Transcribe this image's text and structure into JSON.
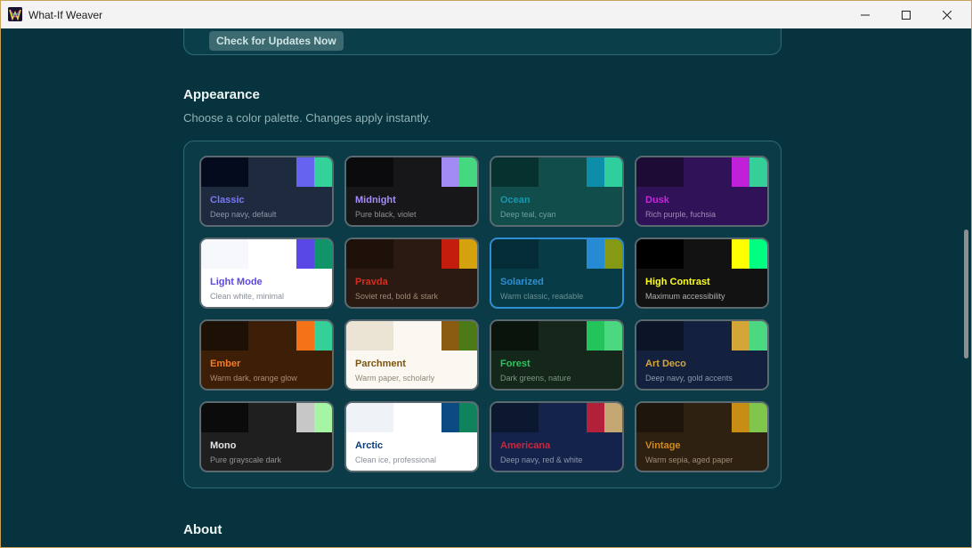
{
  "window": {
    "title": "What-If Weaver",
    "controls": {
      "minimize": "─",
      "maximize": "☐",
      "close": "✕"
    }
  },
  "updates": {
    "button_label": "Check for Updates Now"
  },
  "appearance": {
    "title": "Appearance",
    "subtitle": "Choose a color palette. Changes apply instantly.",
    "selected": "Solarized",
    "palettes": [
      {
        "name": "Classic",
        "desc": "Deep navy, default",
        "colors": [
          "#030b1c",
          "#1e2b3f",
          "#6563f0",
          "#35d19a"
        ],
        "bg": "#1e2b3f",
        "name_color": "#7b78f5",
        "desc_color": "#8b96a8"
      },
      {
        "name": "Midnight",
        "desc": "Pure black, violet",
        "colors": [
          "#0b0b0d",
          "#17171a",
          "#a28bf5",
          "#46d881"
        ],
        "bg": "#17171a",
        "name_color": "#a58df7",
        "desc_color": "#8f8f96"
      },
      {
        "name": "Ocean",
        "desc": "Deep teal, cyan",
        "colors": [
          "#06312e",
          "#114e4b",
          "#0d8ea8",
          "#2ecf9c"
        ],
        "bg": "#114e4b",
        "name_color": "#1597b0",
        "desc_color": "#6f9f9b"
      },
      {
        "name": "Dusk",
        "desc": "Rich purple, fuchsia",
        "colors": [
          "#1d0b33",
          "#2f1257",
          "#c020d8",
          "#35cf9a"
        ],
        "bg": "#2f1257",
        "name_color": "#c528d8",
        "desc_color": "#a08ab8"
      },
      {
        "name": "Light Mode",
        "desc": "Clean white, minimal",
        "colors": [
          "#f7f8fc",
          "#ffffff",
          "#5a48e6",
          "#11946a"
        ],
        "bg": "#ffffff",
        "name_color": "#5a48e6",
        "desc_color": "#8a8f99"
      },
      {
        "name": "Pravda",
        "desc": "Soviet red, bold & stark",
        "colors": [
          "#1e1109",
          "#2a1a12",
          "#c51d0d",
          "#d4a20c"
        ],
        "bg": "#2a1a12",
        "name_color": "#d43020",
        "desc_color": "#a08a78"
      },
      {
        "name": "Solarized",
        "desc": "Warm classic, readable",
        "colors": [
          "#042c36",
          "#073c46",
          "#268bd2",
          "#859a12"
        ],
        "bg": "#073c46",
        "name_color": "#2f8fd6",
        "desc_color": "#6d8e93"
      },
      {
        "name": "High Contrast",
        "desc": "Maximum accessibility",
        "colors": [
          "#000000",
          "#121212",
          "#ffff00",
          "#00ff80"
        ],
        "bg": "#121212",
        "name_color": "#ffff1a",
        "desc_color": "#b0b0b0"
      },
      {
        "name": "Ember",
        "desc": "Warm dark, orange glow",
        "colors": [
          "#1d1106",
          "#3d1f07",
          "#f57317",
          "#35cf9a"
        ],
        "bg": "#3d1f07",
        "name_color": "#f57b2a",
        "desc_color": "#b08d70"
      },
      {
        "name": "Parchment",
        "desc": "Warm paper, scholarly",
        "colors": [
          "#ebe4d5",
          "#fbf8f2",
          "#8a5c12",
          "#4b7a16"
        ],
        "bg": "#fbf8f2",
        "name_color": "#7a5414",
        "desc_color": "#8f8575"
      },
      {
        "name": "Forest",
        "desc": "Dark greens, nature",
        "colors": [
          "#0b140c",
          "#15271a",
          "#24c45d",
          "#4bd880"
        ],
        "bg": "#15271a",
        "name_color": "#29c45d",
        "desc_color": "#7d9582"
      },
      {
        "name": "Art Deco",
        "desc": "Deep navy, gold accents",
        "colors": [
          "#0c1528",
          "#13213f",
          "#d3a637",
          "#4bd880"
        ],
        "bg": "#13213f",
        "name_color": "#d4a63a",
        "desc_color": "#8f97a8"
      },
      {
        "name": "Mono",
        "desc": "Pure grayscale dark",
        "colors": [
          "#0b0b0b",
          "#1f1f1f",
          "#c7c7c7",
          "#a5f5a5"
        ],
        "bg": "#1f1f1f",
        "name_color": "#e4e4e4",
        "desc_color": "#939393"
      },
      {
        "name": "Arctic",
        "desc": "Clean ice, professional",
        "colors": [
          "#eff3f8",
          "#ffffff",
          "#0b4a82",
          "#10835e"
        ],
        "bg": "#ffffff",
        "name_color": "#0d3c72",
        "desc_color": "#8a8f99"
      },
      {
        "name": "Americana",
        "desc": "Deep navy, red & white",
        "colors": [
          "#0c1730",
          "#13234b",
          "#b32039",
          "#c4a873"
        ],
        "bg": "#13234b",
        "name_color": "#c82840",
        "desc_color": "#8f97ab"
      },
      {
        "name": "Vintage",
        "desc": "Warm sepia, aged paper",
        "colors": [
          "#1e150c",
          "#2f2112",
          "#c88d14",
          "#7fc64a"
        ],
        "bg": "#2f2112",
        "name_color": "#d08a1c",
        "desc_color": "#9d8c76"
      }
    ]
  },
  "about": {
    "title": "About"
  }
}
